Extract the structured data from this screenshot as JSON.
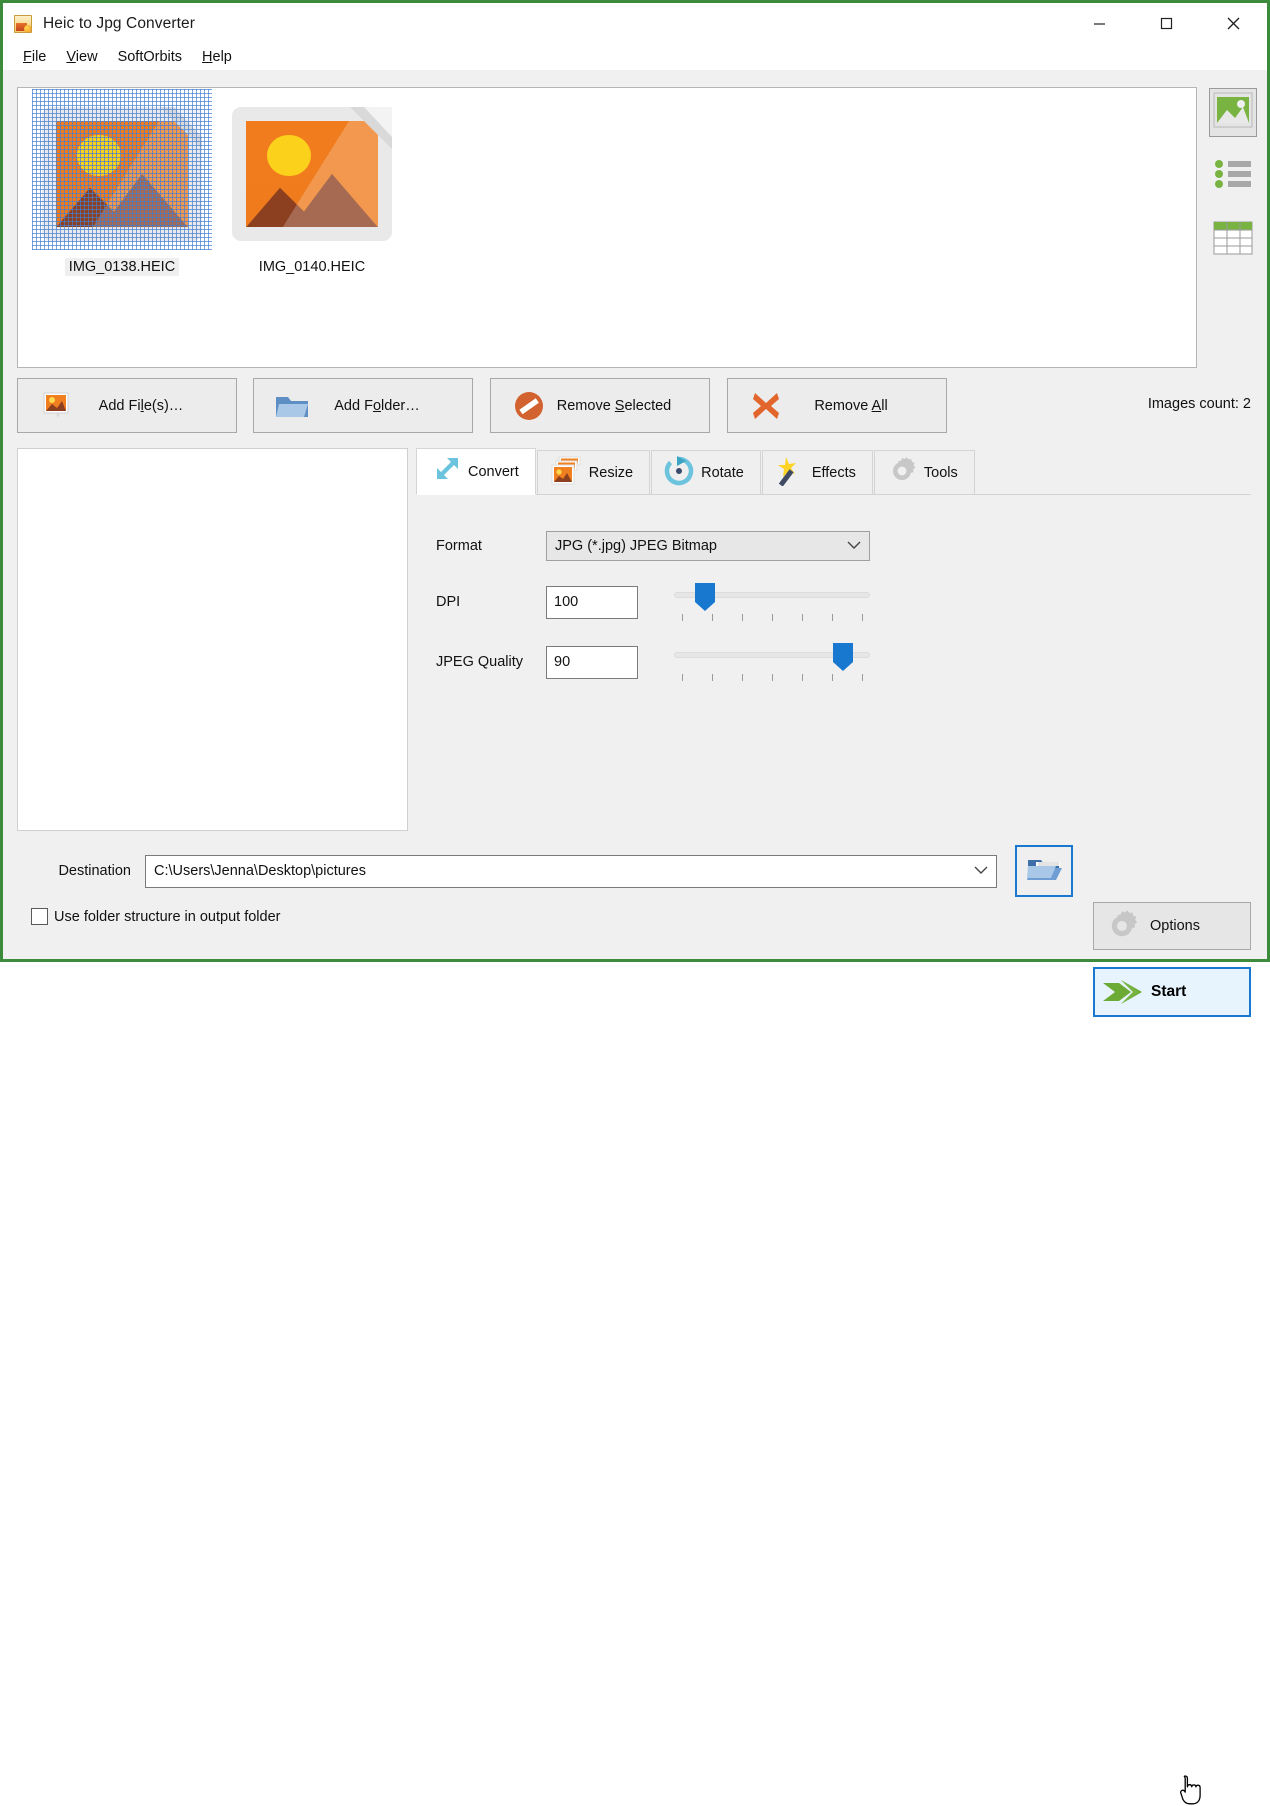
{
  "window": {
    "title": "Heic to Jpg Converter",
    "app_icon": "photo-converter-icon",
    "minimize": "–",
    "maximize": "□",
    "close": "✕",
    "border_color": "#3c8a3c"
  },
  "menubar": {
    "items": [
      {
        "label": "File",
        "accel": "F"
      },
      {
        "label": "View",
        "accel": "V"
      },
      {
        "label": "SoftOrbits",
        "accel": ""
      },
      {
        "label": "Help",
        "accel": "H"
      }
    ]
  },
  "thumbnails": {
    "items": [
      {
        "name": "IMG_0138.HEIC",
        "selected": true
      },
      {
        "name": "IMG_0140.HEIC",
        "selected": false
      }
    ]
  },
  "view_modes": [
    {
      "name": "thumbnail-view",
      "active": true
    },
    {
      "name": "list-view",
      "active": false
    },
    {
      "name": "details-view",
      "active": false
    }
  ],
  "actions": {
    "add_files": {
      "label_pre": "Add Fi",
      "accel": "l",
      "label_post": "e(s)…",
      "icon": "add-image-icon"
    },
    "add_folder": {
      "label_pre": "Add F",
      "accel": "o",
      "label_post": "lder…",
      "icon": "folder-icon"
    },
    "remove_selected": {
      "label_pre": "Remove ",
      "accel": "S",
      "label_post": "elected",
      "icon": "forbidden-icon"
    },
    "remove_all": {
      "label_pre": "Remove ",
      "accel": "A",
      "label_post": "ll",
      "icon": "red-x-icon"
    },
    "images_count": "Images count: 2"
  },
  "tabs": [
    {
      "label": "Convert",
      "icon": "resize-arrows-icon",
      "active": true
    },
    {
      "label": "Resize",
      "icon": "images-stack-icon",
      "active": false
    },
    {
      "label": "Rotate",
      "icon": "rotate-icon",
      "active": false
    },
    {
      "label": "Effects",
      "icon": "magic-wand-icon",
      "active": false
    },
    {
      "label": "Tools",
      "icon": "gear-icon",
      "active": false
    }
  ],
  "convert_panel": {
    "format_label": "Format",
    "format_value": "JPG (*.jpg) JPEG Bitmap",
    "dpi_label": "DPI",
    "dpi_value": "100",
    "dpi_slider_percent": 14,
    "quality_label": "JPEG Quality",
    "quality_value": "90",
    "quality_slider_percent": 87,
    "slider_tick_count": 7
  },
  "bottom": {
    "destination_label": "Destination",
    "destination_value": "C:\\Users\\Jenna\\Desktop\\pictures",
    "browse_icon": "open-folder-icon",
    "options_label": "Options",
    "options_icon": "gear-icon",
    "start_label": "Start",
    "start_icon": "green-arrow-icon",
    "checkbox_label": "Use folder structure in output folder",
    "checkbox_checked": false,
    "accent_color": "#1878cf"
  }
}
